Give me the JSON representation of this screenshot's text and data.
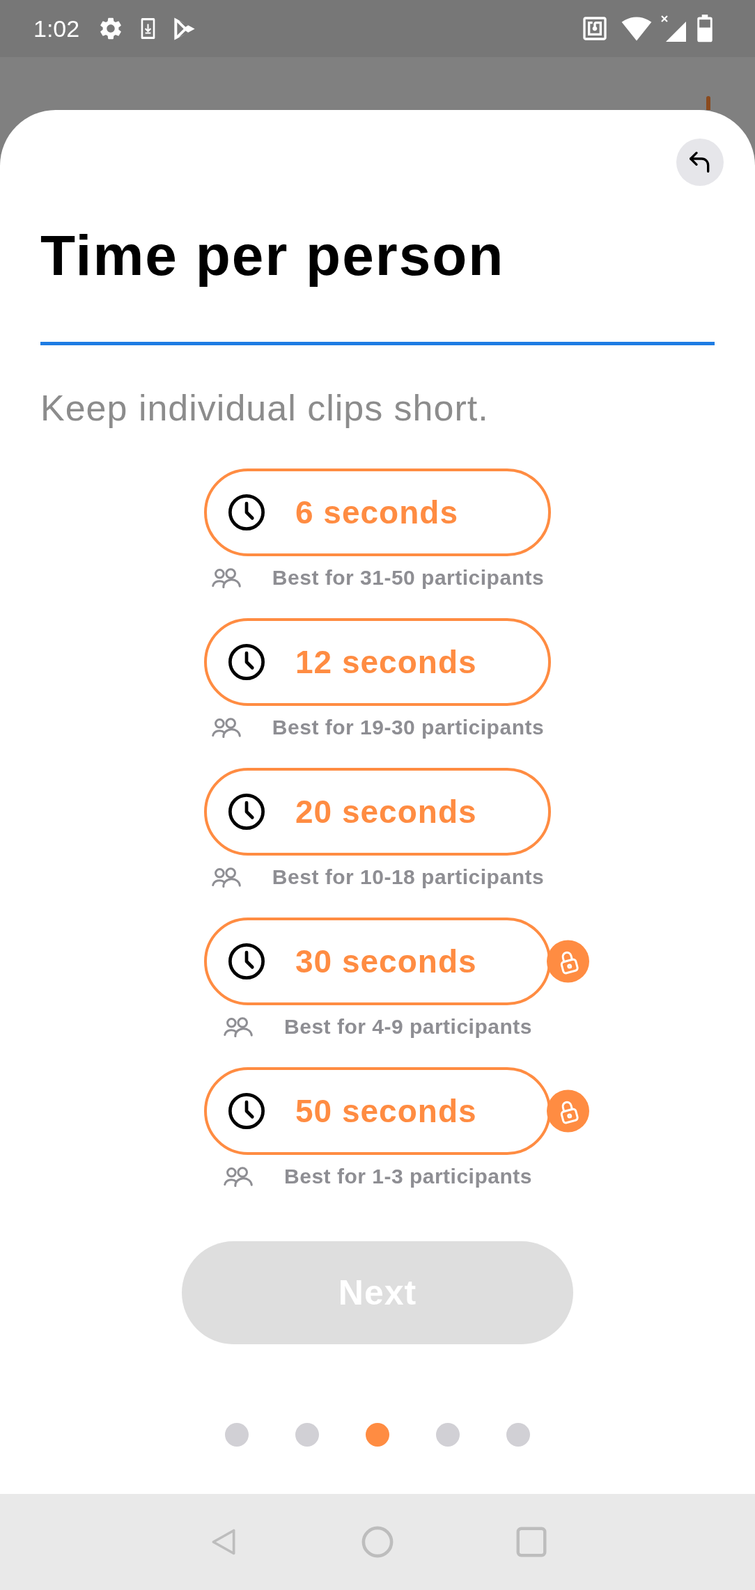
{
  "status_bar": {
    "time": "1:02"
  },
  "sheet": {
    "title": "Time per person",
    "subtitle": "Keep individual clips short."
  },
  "options": [
    {
      "label": "6 seconds",
      "caption": "Best for 31-50 participants",
      "locked": false,
      "selected": false
    },
    {
      "label": "12 seconds",
      "caption": "Best for 19-30 participants",
      "locked": false,
      "selected": false
    },
    {
      "label": "20 seconds",
      "caption": "Best for 10-18 participants",
      "locked": false,
      "selected": false
    },
    {
      "label": "30 seconds",
      "caption": "Best for 4-9 participants",
      "locked": true,
      "selected": false
    },
    {
      "label": "50 seconds",
      "caption": "Best for 1-3 participants",
      "locked": true,
      "selected": false
    }
  ],
  "next_button": {
    "label": "Next",
    "disabled": true
  },
  "pager": [
    {
      "selected": false
    },
    {
      "selected": false
    },
    {
      "selected": true
    },
    {
      "selected": false
    },
    {
      "selected": false
    }
  ]
}
